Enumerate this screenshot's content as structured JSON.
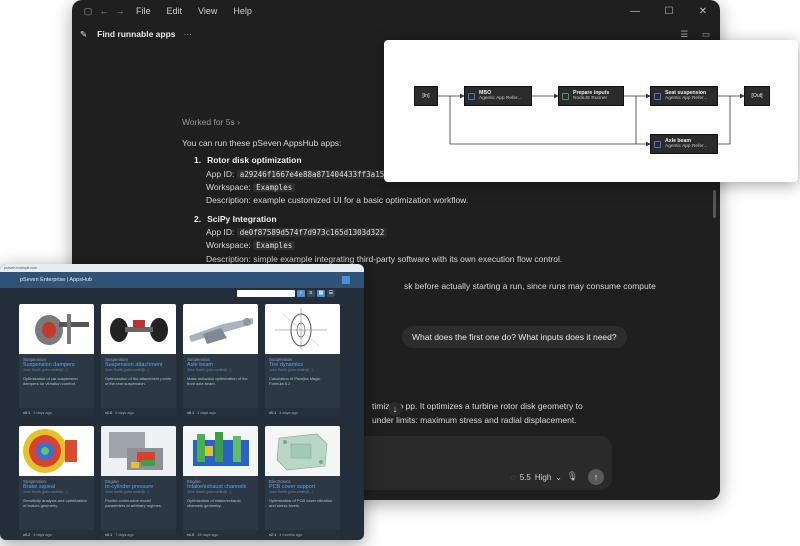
{
  "window": {
    "menu": [
      "File",
      "Edit",
      "View",
      "Help"
    ],
    "thread_title": "Find runnable apps",
    "more_label": "···"
  },
  "chat": {
    "worked_for": "Worked for 5s",
    "intro": "You can run these pSeven AppsHub apps:",
    "apps": [
      {
        "num": "1.",
        "name": "Rotor disk optimization",
        "app_id_label": "App ID:",
        "app_id": "a29246f1667e4e88a871404433ff3a15",
        "workspace_label": "Workspace:",
        "workspace": "Examples",
        "description_label": "Description:",
        "description": "example customized UI for a basic optimization workflow."
      },
      {
        "num": "2.",
        "name": "SciPy Integration",
        "app_id_label": "App ID:",
        "app_id": "de0f87589d574f7d973c165d1303d322",
        "workspace_label": "Workspace:",
        "workspace": "Examples",
        "description_label": "Description:",
        "description": "simple example integrating third-party software with its own execution flow control."
      }
    ],
    "note_fragment_1": "sk before actually starting a run, since runs may consume compute",
    "user_message": "What does the first one do? What inputs does it need?",
    "answer_fragment_1": "timizatio   pp. It optimizes a turbine rotor disk geometry to",
    "answer_fragment_2": "under limits: maximum stress and radial displacement."
  },
  "composer": {
    "model": "5.5",
    "effort": "High"
  },
  "diagram": {
    "nodes": [
      {
        "id": "in",
        "label": "[In]"
      },
      {
        "id": "mbo",
        "title": "MBO",
        "sub": "Agentic App Refer..."
      },
      {
        "id": "prep",
        "title": "Prepare inputs",
        "sub": "NodeJS Runner"
      },
      {
        "id": "seat",
        "title": "Seat suspension",
        "sub": "Agentic App Refer..."
      },
      {
        "id": "out",
        "label": "[Out]"
      },
      {
        "id": "axle",
        "title": "Axle beam",
        "sub": "Agentic App Refer..."
      }
    ]
  },
  "appshub": {
    "chrome_text": "pseven.example.com",
    "header_title": "pSeven Enterprise | AppsHub",
    "cards": [
      {
        "category": "Suspension",
        "name": "Suspension dampers",
        "sub": "John Smith (john.smith@...)",
        "desc": "Optimization of car suspension dampers for vibration comfort.",
        "version": "v0.1",
        "age": "3 days ago",
        "thumb": "damper"
      },
      {
        "category": "Suspension",
        "name": "Suspension attachment",
        "sub": "John Smith (john.smith@...)",
        "desc": "Optimization of the attachment points of the rear suspension.",
        "version": "v1.0",
        "age": "5 days ago",
        "thumb": "attach"
      },
      {
        "category": "Suspension",
        "name": "Axle beam",
        "sub": "John Smith (john.smith@...)",
        "desc": "Mass reduction optimization of the front axle beam.",
        "version": "v0.1",
        "age": "4 days ago",
        "thumb": "axle"
      },
      {
        "category": "Suspension",
        "name": "Tire dynamics",
        "sub": "John Smith (john.smith@...)",
        "desc": "Calculation of Pacejka Magic Formula 5.2",
        "version": "v0.1",
        "age": "4 days ago",
        "thumb": "tire"
      },
      {
        "category": "Suspension",
        "name": "Brake squeal",
        "sub": "John Smith (john.smith@...)",
        "desc": "Sensitivity analysis and optimization of brakes geometry.",
        "version": "v0.2",
        "age": "4 days ago",
        "thumb": "brake"
      },
      {
        "category": "Engine",
        "name": "In-cylinder pressure",
        "sub": "John Smith (john.smith@...)",
        "desc": "Predict combustion model parameters at arbitrary regimes.",
        "version": "v0.1",
        "age": "7 days ago",
        "thumb": "cylinder"
      },
      {
        "category": "Engine",
        "name": "Intake/exhaust channels",
        "sub": "John Smith (john.smith@...)",
        "desc": "Optimization of intake/exhaust channels geometry.",
        "version": "v1.0",
        "age": "15 days ago",
        "thumb": "channels"
      },
      {
        "category": "Electronics",
        "name": "PCB cover support",
        "sub": "John Smith (john.smith@...)",
        "desc": "Optimization of PCB cover vibration and stress levels.",
        "version": "v2.1",
        "age": "4 months ago",
        "thumb": "pcb"
      }
    ]
  },
  "colors": {
    "main_bg": "#1f1f1f",
    "apps_bg": "#232e3a",
    "apps_header": "#2f5276",
    "accent_blue": "#5ea8ec"
  }
}
